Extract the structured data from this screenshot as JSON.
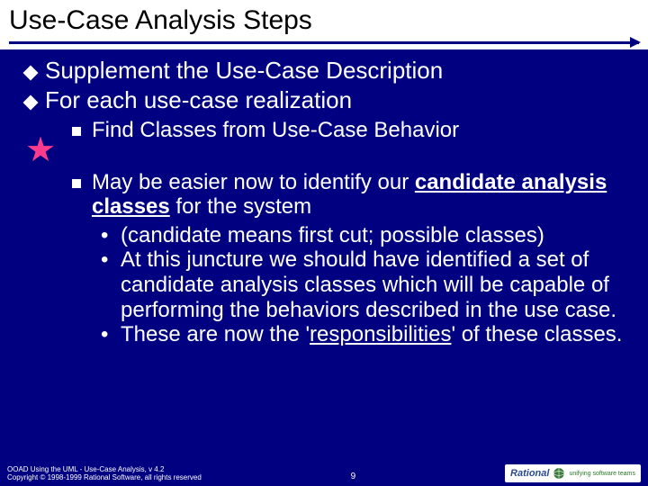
{
  "title": "Use-Case Analysis Steps",
  "l1": {
    "a": "Supplement the Use-Case Description",
    "b": "For each use-case realization"
  },
  "l2": {
    "a": "Find Classes from Use-Case Behavior",
    "b_pre": "May be easier now to identify our ",
    "b_u1": "candidate analysis classes",
    "b_post": " for the system"
  },
  "l3": {
    "a": "(candidate means first cut; possible classes)",
    "b": "At this juncture we should have identified a set of candidate analysis classes which will be capable of performing the behaviors described in the use case.",
    "c_pre": "These are now the '",
    "c_u": "responsibilities",
    "c_post": "' of these classes."
  },
  "footer": {
    "line1": "OOAD Using the UML - Use-Case Analysis, v 4.2",
    "line2": "Copyright © 1998-1999 Rational Software, all rights reserved",
    "page": "9",
    "logo_name": "Rational",
    "logo_tag": "unifying software teams"
  }
}
